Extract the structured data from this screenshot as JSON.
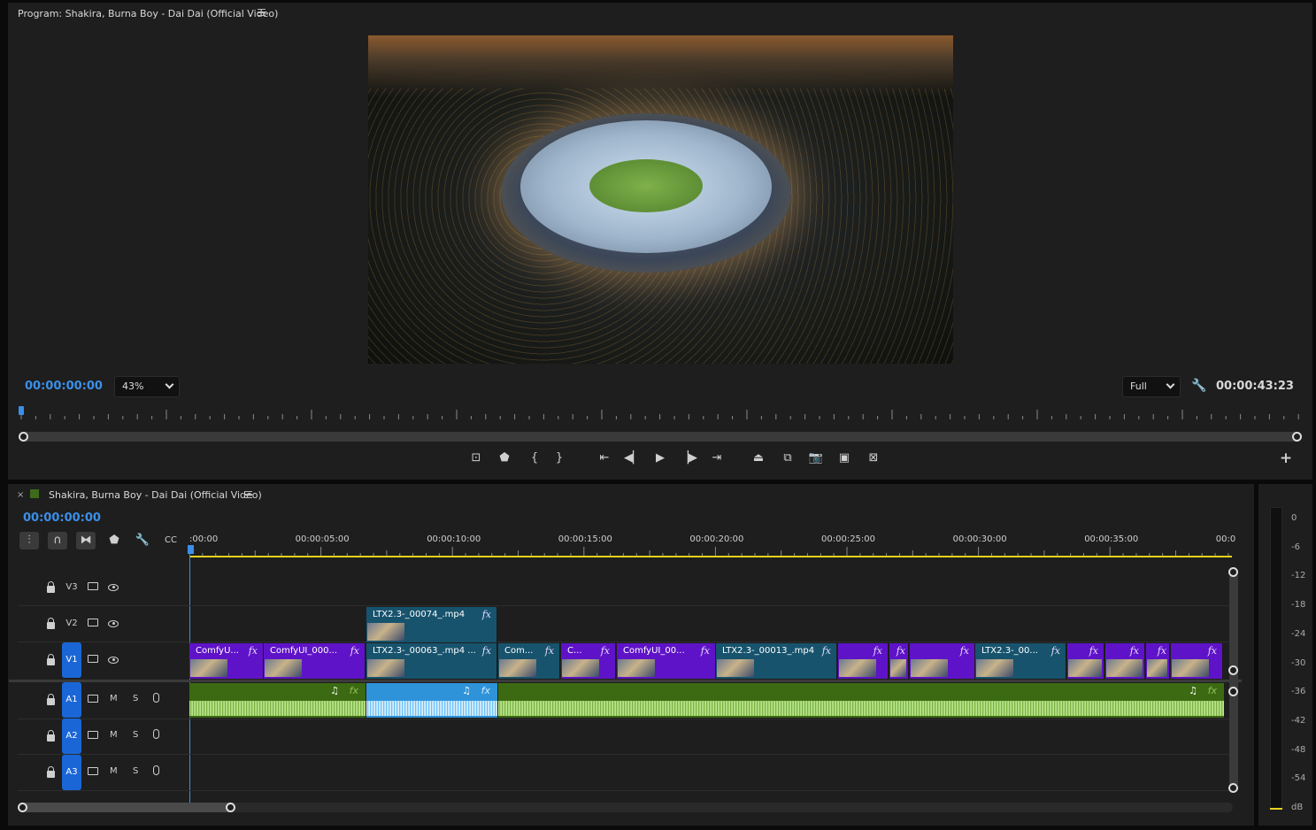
{
  "program_monitor": {
    "title": "Program: Shakira, Burna Boy - Dai Dai (Official Video)",
    "timecode": "00:00:00:00",
    "zoom": "43%",
    "resolution": "Full",
    "duration": "00:00:43:23",
    "playhead_fraction": 0.0
  },
  "transport_icons": [
    "add-marker-icon",
    "marker-icon",
    "mark-in-icon",
    "mark-out-icon",
    "go-to-in-icon",
    "step-back-icon",
    "play-icon",
    "step-forward-icon",
    "go-to-out-icon",
    "lift-icon",
    "extract-icon",
    "export-frame-icon",
    "insert-icon",
    "comparison-view-icon",
    "add-button-icon"
  ],
  "timeline": {
    "title": "Shakira, Burna Boy - Dai Dai (Official Video)",
    "timecode": "00:00:00:00",
    "ruler": [
      ":00:00",
      "00:00:05:00",
      "00:00:10:00",
      "00:00:15:00",
      "00:00:20:00",
      "00:00:25:00",
      "00:00:30:00",
      "00:00:35:00",
      "00:0"
    ],
    "tracks": [
      {
        "name": "V3",
        "type": "video"
      },
      {
        "name": "V2",
        "type": "video"
      },
      {
        "name": "V1",
        "type": "video",
        "active": true
      },
      {
        "name": "A1",
        "type": "audio",
        "active": true
      },
      {
        "name": "A2",
        "type": "audio",
        "active": true
      },
      {
        "name": "A3",
        "type": "audio",
        "active": true
      }
    ],
    "mute_label": "M",
    "solo_label": "S",
    "fx_label": "fx",
    "v2_clips": [
      {
        "name": "LTX2.3-_00074_.mp4"
      }
    ],
    "v1_clips": [
      {
        "name": "ComfyU..."
      },
      {
        "name": "ComfyUI_000..."
      },
      {
        "name": "LTX2.3-_00063_.mp4 ..."
      },
      {
        "name": "Com..."
      },
      {
        "name": "C..."
      },
      {
        "name": "ComfyUI_00..."
      },
      {
        "name": "LTX2.3-_00013_.mp4"
      },
      {
        "name": ""
      },
      {
        "name": ""
      },
      {
        "name": ""
      },
      {
        "name": "LTX2.3-_00..."
      },
      {
        "name": ""
      },
      {
        "name": ""
      },
      {
        "name": ""
      },
      {
        "name": ""
      }
    ]
  },
  "audio_meter": {
    "labels": [
      "0",
      "-6",
      "-12",
      "-18",
      "-24",
      "-30",
      "-36",
      "-42",
      "-48",
      "-54",
      "dB"
    ]
  },
  "colors": {
    "accent_blue": "#3b8fe8",
    "clip_violet": "#5f13c8",
    "clip_teal": "#17536d",
    "audio_green": "#3b6a12",
    "audio_selected": "#2e93d9",
    "work_area": "#e8d21c"
  }
}
